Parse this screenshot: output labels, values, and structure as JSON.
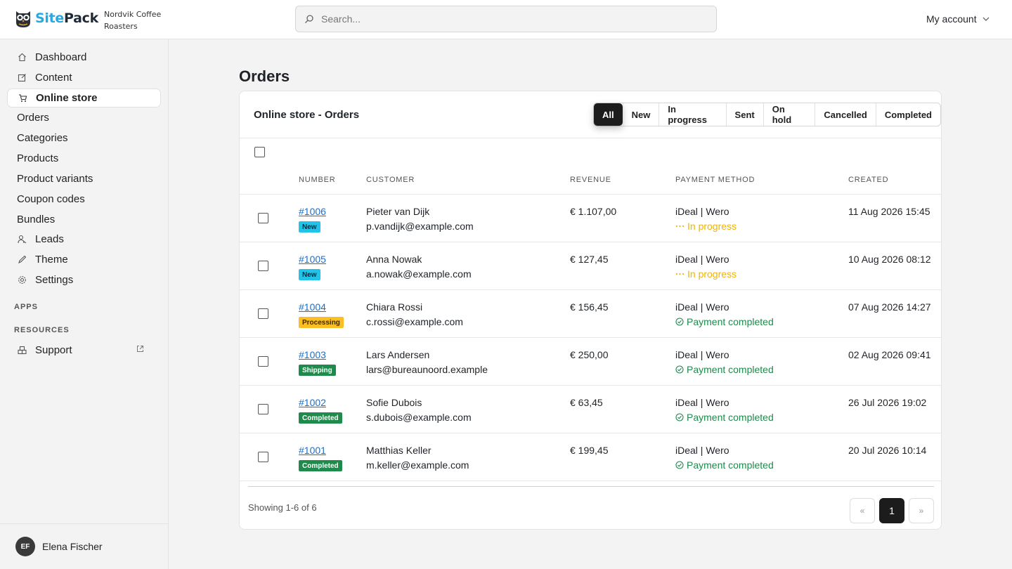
{
  "header": {
    "brand_part1": "Site",
    "brand_part2": "Pack",
    "site_name": "Nordvik Coffee Roasters",
    "search_placeholder": "Search...",
    "account_label": "My account"
  },
  "sidebar": {
    "items": [
      {
        "label": "Dashboard"
      },
      {
        "label": "Content"
      },
      {
        "label": "Online store"
      }
    ],
    "sub_items": [
      {
        "label": "Orders"
      },
      {
        "label": "Categories"
      },
      {
        "label": "Products"
      },
      {
        "label": "Product variants"
      },
      {
        "label": "Coupon codes"
      },
      {
        "label": "Bundles"
      }
    ],
    "items2": [
      {
        "label": "Leads"
      },
      {
        "label": "Theme"
      },
      {
        "label": "Settings"
      }
    ],
    "section_apps": "APPS",
    "section_resources": "RESOURCES",
    "support_label": "Support",
    "user": {
      "initials": "EF",
      "name": "Elena Fischer"
    }
  },
  "main": {
    "page_title": "Orders",
    "card_title": "Online store - Orders",
    "filters": [
      {
        "label": "All"
      },
      {
        "label": "New"
      },
      {
        "label": "In progress"
      },
      {
        "label": "Sent"
      },
      {
        "label": "On hold"
      },
      {
        "label": "Cancelled"
      },
      {
        "label": "Completed"
      }
    ],
    "columns": {
      "number": "NUMBER",
      "customer": "CUSTOMER",
      "revenue": "REVENUE",
      "payment": "PAYMENT METHOD",
      "created": "CREATED"
    },
    "orders": [
      {
        "number": "#1006",
        "status": "New",
        "name": "Pieter van Dijk",
        "email": "p.vandijk@example.com",
        "revenue": "€ 1.107,00",
        "method": "iDeal | Wero",
        "payment_status": "In progress",
        "created": "11 Aug 2026 15:45"
      },
      {
        "number": "#1005",
        "status": "New",
        "name": "Anna Nowak",
        "email": "a.nowak@example.com",
        "revenue": "€ 127,45",
        "method": "iDeal | Wero",
        "payment_status": "In progress",
        "created": "10 Aug 2026 08:12"
      },
      {
        "number": "#1004",
        "status": "Processing",
        "name": "Chiara Rossi",
        "email": "c.rossi@example.com",
        "revenue": "€ 156,45",
        "method": "iDeal | Wero",
        "payment_status": "Payment completed",
        "created": "07 Aug 2026 14:27"
      },
      {
        "number": "#1003",
        "status": "Shipping",
        "name": "Lars Andersen",
        "email": "lars@bureaunoord.example",
        "revenue": "€ 250,00",
        "method": "iDeal | Wero",
        "payment_status": "Payment completed",
        "created": "02 Aug 2026 09:41"
      },
      {
        "number": "#1002",
        "status": "Completed",
        "name": "Sofie Dubois",
        "email": "s.dubois@example.com",
        "revenue": "€ 63,45",
        "method": "iDeal | Wero",
        "payment_status": "Payment completed",
        "created": "26 Jul 2026 19:02"
      },
      {
        "number": "#1001",
        "status": "Completed",
        "name": "Matthias Keller",
        "email": "m.keller@example.com",
        "revenue": "€ 199,45",
        "method": "iDeal | Wero",
        "payment_status": "Payment completed",
        "created": "20 Jul 2026 10:14"
      }
    ],
    "pagination": {
      "showing": "Showing 1-6 of 6",
      "prev": "«",
      "page": "1",
      "next": "»"
    }
  },
  "colors": {
    "badge_new": "#22c3ea",
    "badge_processing": "#fbbf24",
    "badge_shipping": "#1f8a4c",
    "badge_completed": "#1f8a4c",
    "in_progress": "#f0b400",
    "payment_completed": "#1f8a4c",
    "link": "#1a6fd1"
  }
}
